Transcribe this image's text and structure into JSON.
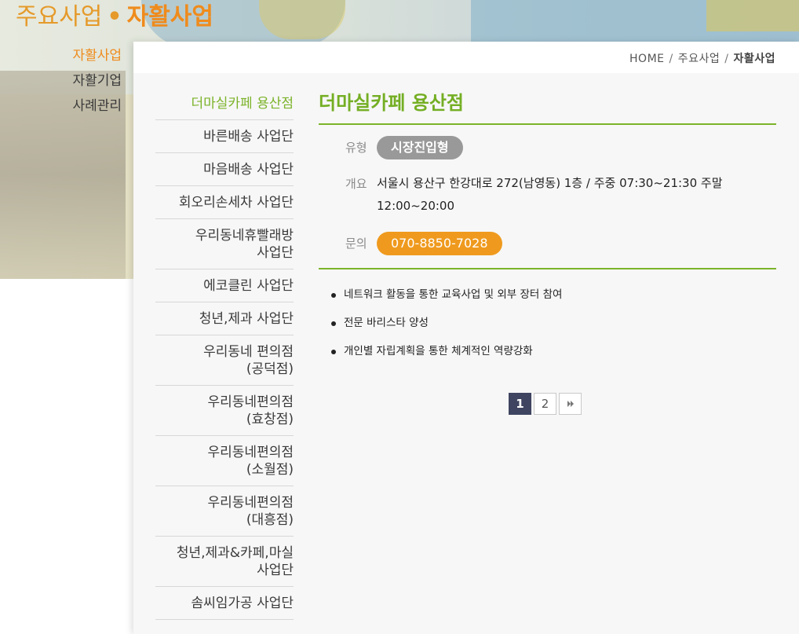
{
  "header": {
    "section": "주요사업",
    "separator": "•",
    "current": "자활사업"
  },
  "left_nav": {
    "items": [
      {
        "label": "자활사업",
        "active": true
      },
      {
        "label": "자활기업",
        "active": false
      },
      {
        "label": "사례관리",
        "active": false
      }
    ]
  },
  "breadcrumb": {
    "home": "HOME",
    "sep": "/",
    "level1": "주요사업",
    "level2": "자활사업"
  },
  "sub_menu": {
    "items": [
      {
        "label": "더마실카페 용산점",
        "active": true
      },
      {
        "label": "바른배송 사업단"
      },
      {
        "label": "마음배송 사업단"
      },
      {
        "label": "회오리손세차 사업단"
      },
      {
        "label": "우리동네휴빨래방\n사업단"
      },
      {
        "label": "에코클린 사업단"
      },
      {
        "label": "청년,제과 사업단"
      },
      {
        "label": "우리동네 편의점\n(공덕점)"
      },
      {
        "label": "우리동네편의점\n(효창점)"
      },
      {
        "label": "우리동네편의점\n(소월점)"
      },
      {
        "label": "우리동네편의점\n(대흥점)"
      },
      {
        "label": "청년,제과&카페,마실\n사업단"
      },
      {
        "label": "솜씨임가공 사업단"
      }
    ]
  },
  "detail": {
    "title": "더마실카페 용산점",
    "type_label": "유형",
    "type_value": "시장진입형",
    "overview_label": "개요",
    "overview_value": "서울시 용산구 한강대로 272(남영동) 1층 / 주중 07:30~21:30 주말 12:00~20:00",
    "contact_label": "문의",
    "contact_value": "070-8850-7028",
    "bullets": [
      "네트워크 활동을 통한 교육사업 및 외부 장터 참여",
      "전문 바리스타 양성",
      "개인별 자립계획을 통한 체계적인 역량강화"
    ]
  },
  "pagination": {
    "pages": [
      "1",
      "2"
    ],
    "current": "1",
    "next_icon": "next-icon"
  },
  "colors": {
    "accent_green": "#7cb32a",
    "accent_orange": "#ef8b1c",
    "badge_gray": "#999999",
    "pager_active": "#3f4560"
  }
}
